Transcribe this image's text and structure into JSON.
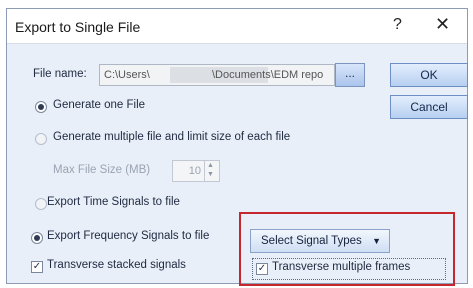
{
  "dialog": {
    "title": "Export to Single File",
    "help_label": "?",
    "close_label": "✕"
  },
  "file": {
    "label": "File name:",
    "path_start": "C:\\Users\\",
    "path_end": "\\Documents\\EDM repo",
    "browse_label": "..."
  },
  "buttons": {
    "ok": "OK",
    "cancel": "Cancel"
  },
  "options": {
    "generate_one": "Generate one File",
    "generate_multiple": "Generate multiple file and limit size of each file",
    "max_size_label": "Max File Size (MB)",
    "max_size_value": "10",
    "export_time": "Export Time Signals to file",
    "export_freq": "Export Frequency Signals to file",
    "transverse_stacked": "Transverse stacked signals",
    "select_signal_types": "Select Signal Types",
    "transverse_frames": "Transverse multiple frames"
  },
  "state": {
    "generate_one_selected": true,
    "export_freq_selected": true,
    "transverse_stacked_checked": true,
    "transverse_frames_checked": true
  },
  "colors": {
    "highlight_box": "#c4282e"
  }
}
